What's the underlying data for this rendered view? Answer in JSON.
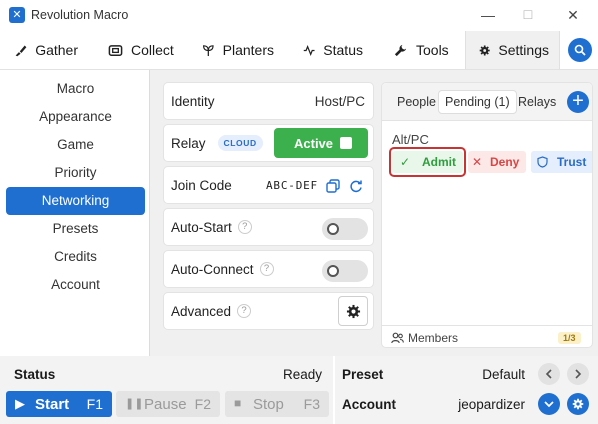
{
  "window": {
    "title": "Revolution Macro",
    "minimize": "—",
    "maximize": "☐",
    "close": "✕"
  },
  "tabs": [
    {
      "label": "Gather",
      "icon": "brush-icon"
    },
    {
      "label": "Collect",
      "icon": "collect-icon"
    },
    {
      "label": "Planters",
      "icon": "sprout-icon"
    },
    {
      "label": "Status",
      "icon": "pulse-icon"
    },
    {
      "label": "Tools",
      "icon": "wrench-icon"
    },
    {
      "label": "Settings",
      "icon": "gear-icon",
      "active": true
    }
  ],
  "sidebar": {
    "items": [
      {
        "label": "Macro"
      },
      {
        "label": "Appearance"
      },
      {
        "label": "Game"
      },
      {
        "label": "Priority"
      },
      {
        "label": "Networking",
        "active": true
      },
      {
        "label": "Presets"
      },
      {
        "label": "Credits"
      },
      {
        "label": "Account"
      }
    ]
  },
  "networking": {
    "identity": {
      "label": "Identity",
      "value": "Host/PC"
    },
    "relay": {
      "label": "Relay",
      "badge": "CLOUD",
      "state": "Active"
    },
    "join_code": {
      "label": "Join Code",
      "value": "ABC-DEF"
    },
    "auto_start": {
      "label": "Auto-Start",
      "help": "?",
      "enabled": false
    },
    "auto_connect": {
      "label": "Auto-Connect",
      "help": "?",
      "enabled": false
    },
    "advanced": {
      "label": "Advanced",
      "help": "?"
    }
  },
  "peers": {
    "tabs": [
      {
        "label": "People"
      },
      {
        "label": "Pending (1)",
        "active": true
      },
      {
        "label": "Relays"
      }
    ],
    "add_label": "+",
    "pending": [
      {
        "name": "Alt/PC",
        "admit": "Admit",
        "deny": "Deny",
        "trust": "Trust",
        "admit_icon": "✓",
        "deny_icon": "✕"
      }
    ],
    "members_label": "Members",
    "members_count": "1/3"
  },
  "status_bar": {
    "status_label": "Status",
    "status_value": "Ready",
    "preset_label": "Preset",
    "preset_value": "Default",
    "account_label": "Account",
    "account_value": "jeopardizer",
    "start": {
      "label": "Start",
      "key": "F1",
      "icon": "▶"
    },
    "pause": {
      "label": "Pause",
      "key": "F2",
      "icon": "❚❚"
    },
    "stop": {
      "label": "Stop",
      "key": "F3",
      "icon": "■"
    }
  },
  "colors": {
    "accent": "#1f6fd1",
    "active_green": "#3cb04c",
    "deny_red": "#d94545",
    "highlight_border": "#c83434"
  }
}
